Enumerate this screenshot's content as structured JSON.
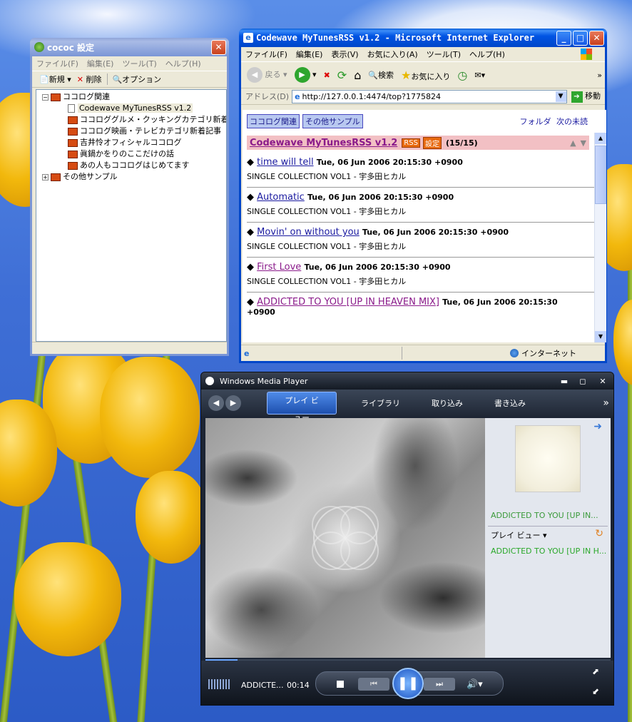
{
  "cococ": {
    "title": "cococ 設定",
    "menu": [
      "ファイル(F)",
      "編集(E)",
      "ツール(T)",
      "ヘルプ(H)"
    ],
    "toolbar": {
      "new_label": "新規",
      "delete_label": "削除",
      "options_label": "オプション"
    },
    "tree": {
      "group1": "ココログ関連",
      "items": [
        "Codewave MyTunesRSS v1.2",
        "ココロググルメ・クッキングカテゴリ新着記事",
        "ココログ映画・テレビカテゴリ新着記事",
        "吉井怜オフィシャルココログ",
        "眞鍋かをりのここだけの話",
        "あの人もココログはじめてます"
      ],
      "group2": "その他サンプル"
    }
  },
  "ie": {
    "title": "Codewave MyTunesRSS v1.2 - Microsoft Internet Explorer",
    "menu": [
      "ファイル(F)",
      "編集(E)",
      "表示(V)",
      "お気に入り(A)",
      "ツール(T)",
      "ヘルプ(H)"
    ],
    "toolbar": {
      "back": "戻る",
      "search": "検索",
      "favorites": "お気に入り"
    },
    "address_label": "アドレス(D)",
    "address_value": "http://127.0.0.1:4474/top?1775824",
    "go_label": "移動",
    "chips": [
      "ココログ関連",
      "その他サンプル"
    ],
    "nav_right": {
      "folder": "フォルダ",
      "next_unread": "次の未読"
    },
    "feed": {
      "title": "Codewave MyTunesRSS v1.2",
      "rss": "RSS",
      "settings": "設定",
      "count": "(15/15)"
    },
    "entries": [
      {
        "title": "time will tell",
        "date": "Tue, 06 Jun 2006 20:15:30 +0900",
        "sub": "SINGLE COLLECTION VOL1 - 宇多田ヒカル"
      },
      {
        "title": "Automatic",
        "date": "Tue, 06 Jun 2006 20:15:30 +0900",
        "sub": "SINGLE COLLECTION VOL1 - 宇多田ヒカル"
      },
      {
        "title": "Movin' on without you",
        "date": "Tue, 06 Jun 2006 20:15:30 +0900",
        "sub": "SINGLE COLLECTION VOL1 - 宇多田ヒカル"
      },
      {
        "title": "First Love",
        "date": "Tue, 06 Jun 2006 20:15:30 +0900",
        "sub": "SINGLE COLLECTION VOL1 - 宇多田ヒカル"
      },
      {
        "title": "ADDICTED TO YOU [UP IN HEAVEN MIX]",
        "date": "Tue, 06 Jun 2006 20:15:30",
        "date2": "+0900"
      }
    ],
    "status_zone": "インターネット"
  },
  "wmp": {
    "title": "Windows Media Player",
    "tabs": [
      "プレイ ビュー",
      "ライブラリ",
      "取り込み",
      "書き込み"
    ],
    "now_playing": "ADDICTED TO YOU [UP IN...",
    "playlist_label": "プレイ ビュー",
    "playlist_item": "ADDICTED TO YOU [UP IN H...",
    "track_short": "ADDICTE...",
    "time": "00:14",
    "progress": 0.08
  },
  "colors": {
    "xp_blue": "#0054e3",
    "feed_header_bg": "#f2c0c4",
    "feed_title": "#8a1a8a",
    "rss_badge": "#e86a10",
    "wmp_green": "#3a9a3a"
  }
}
